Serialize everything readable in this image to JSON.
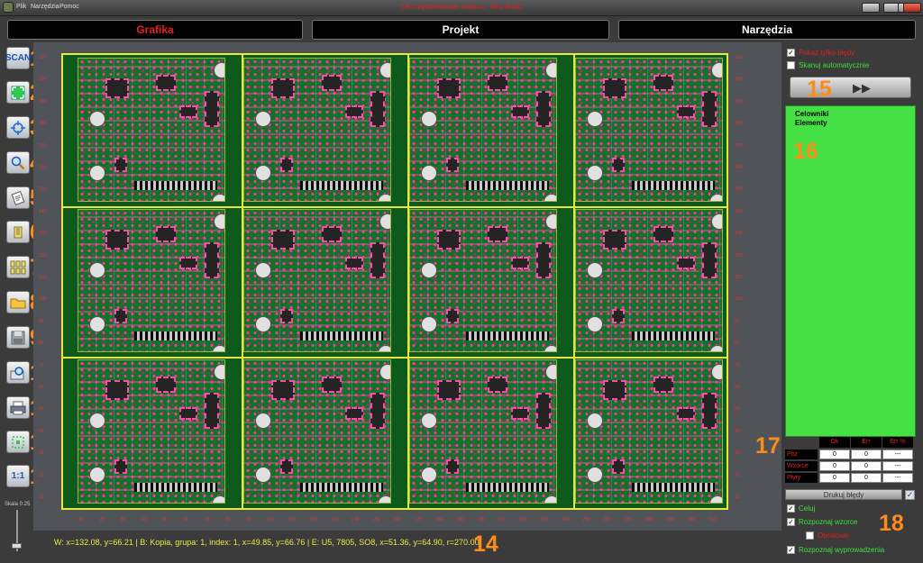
{
  "titlebar": {
    "title": "Oszczędnościowe sodium - Bez tłużki",
    "menu": [
      "Plik",
      "Narzędzia",
      "Pomoc"
    ]
  },
  "tabs": [
    "Grafika",
    "Projekt",
    "Narzędzia"
  ],
  "toolbar": {
    "scan_label": "SCAN",
    "one_to_one_label": "1:1",
    "markers": [
      "1",
      "2",
      "3",
      "4",
      "5",
      "6",
      "7",
      "8",
      "9",
      "10",
      "11",
      "12",
      "13"
    ],
    "scale_label": "Skala 0.25"
  },
  "ruler": {
    "left": [
      "210",
      "200",
      "190",
      "180",
      "170",
      "160",
      "150",
      "140",
      "130",
      "120",
      "110",
      "100",
      "90",
      "80",
      "70",
      "60",
      "50",
      "40",
      "30",
      "20",
      "10"
    ],
    "bottom": [
      "10",
      "20",
      "30",
      "40",
      "50",
      "60",
      "70",
      "80",
      "90",
      "100",
      "110",
      "120",
      "130",
      "140",
      "150",
      "160",
      "170",
      "180",
      "190",
      "200",
      "210",
      "220",
      "230",
      "240",
      "250",
      "260",
      "270",
      "280",
      "290",
      "300",
      "310"
    ]
  },
  "status": {
    "text": "W: x=132.08, y=66.21 | B: Kopia, grupa: 1, index: 1, x=49.85, y=66.76 | E: U5, 7805, SO8, x=51.36, y=64.90, r=270.00",
    "marker": "14"
  },
  "right_panel": {
    "show_only_errors": "Pokaż tylko błędy",
    "scan_auto": "Skanuj automatycznie",
    "marker_15": "15",
    "list": [
      "Celowniki",
      "Elementy"
    ],
    "marker_16": "16",
    "marker_17": "17",
    "stats_headers": [
      "Ok",
      "Err",
      "Err %"
    ],
    "stats_rows": [
      {
        "label": "Poz",
        "values": [
          "0",
          "0",
          "---"
        ]
      },
      {
        "label": "Wzorce",
        "values": [
          "0",
          "0",
          "---"
        ]
      },
      {
        "label": "Płyty",
        "values": [
          "0",
          "0",
          "---"
        ]
      }
    ],
    "print_errors": "Drukuj błędy",
    "aim": "Celuj",
    "recognize_patterns": "Rozpoznaj wzorce",
    "rotations": "Obrotowo",
    "recognize_leads": "Rozpoznaj wyprowadzenia",
    "marker_18": "18"
  },
  "colors": {
    "accent_orange": "#ff8c1a",
    "panel_green": "#44e044",
    "pcb_green": "#13722a",
    "highlight_red": "#e82020",
    "status_yellow": "#eaea40"
  }
}
